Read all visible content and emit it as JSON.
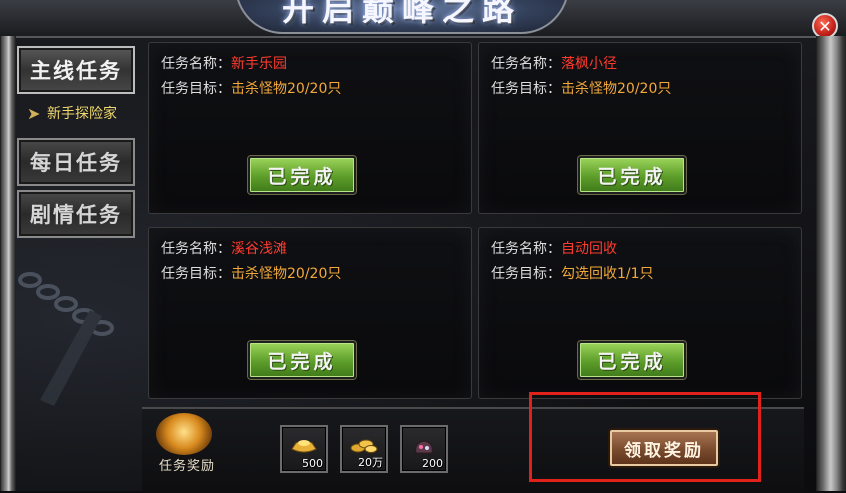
{
  "window": {
    "title": "开启巅峰之路",
    "close_glyph": "✕"
  },
  "menu": {
    "items": [
      {
        "label": "主线任务",
        "active": true
      },
      {
        "label": "每日任务",
        "active": false
      },
      {
        "label": "剧情任务",
        "active": false
      }
    ],
    "sub_item": {
      "label": "新手探险家",
      "arrow": "➤"
    }
  },
  "quest_labels": {
    "name": "任务名称：",
    "goal": "任务目标："
  },
  "quests": [
    {
      "name": "新手乐园",
      "goal": "击杀怪物20/20只",
      "button": "已完成"
    },
    {
      "name": "落枫小径",
      "goal": "击杀怪物20/20只",
      "button": "已完成"
    },
    {
      "name": "溪谷浅滩",
      "goal": "击杀怪物20/20只",
      "button": "已完成"
    },
    {
      "name": "自动回收",
      "goal": "勾选回收1/1只",
      "button": "已完成"
    }
  ],
  "reward": {
    "label": "任务奖励",
    "items": [
      {
        "icon": "gold-ingot-icon",
        "count": "500"
      },
      {
        "icon": "gold-coins-icon",
        "count": "20万"
      },
      {
        "icon": "gem-pouch-icon",
        "count": "200"
      }
    ],
    "claim_label": "领取奖励"
  },
  "colors": {
    "quest_name": "#ff3b2f",
    "quest_goal": "#f2a93a",
    "done_button": "#5d9d2a",
    "highlight": "#e0221b"
  }
}
